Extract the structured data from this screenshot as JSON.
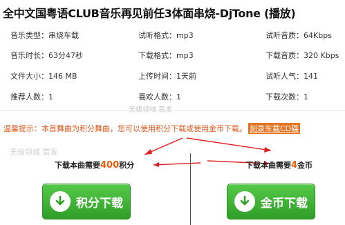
{
  "title": "全中文国粤语CLUB音乐再见前任3体面串烧-DjTone (播放)",
  "info": {
    "type_label": "音乐类型：串烧车载",
    "format_label": "试听格式：mp3",
    "quality_label": "试听音质：64Kbps",
    "duration_label": "音乐时长：63分47秒",
    "download_format_label": "下载格式：mp3",
    "download_quality_label": "下载音质：320 Kbps",
    "size_label": "文件大小：146 MB",
    "upload_label": "上传时间：1天前",
    "popularity_label": "试听人气：141",
    "recommend_label": "推荐人数：1",
    "like_label": "喜欢人数：1",
    "downloads_label": "下载次数：1"
  },
  "watermark_small": "无极领域 首发",
  "watermark_large": "无极领域 首发",
  "notice": {
    "prefix": "温馨提示：",
    "text": "本首舞曲为积分舞曲，您可以使用积分下载或使用金币下载。",
    "link": "刻录车载CD碟"
  },
  "points": {
    "prefix": "下载本曲需要",
    "value": "400",
    "suffix": "积分"
  },
  "coins": {
    "prefix": "下载本曲需要",
    "value": "4",
    "suffix": "金币"
  },
  "buttons": {
    "points_label": "积分下载",
    "coins_label": "金币下载"
  },
  "colors": {
    "accent": "#e85d0c",
    "button_green": "#2f9e27",
    "arrow_red": "#e02020"
  }
}
